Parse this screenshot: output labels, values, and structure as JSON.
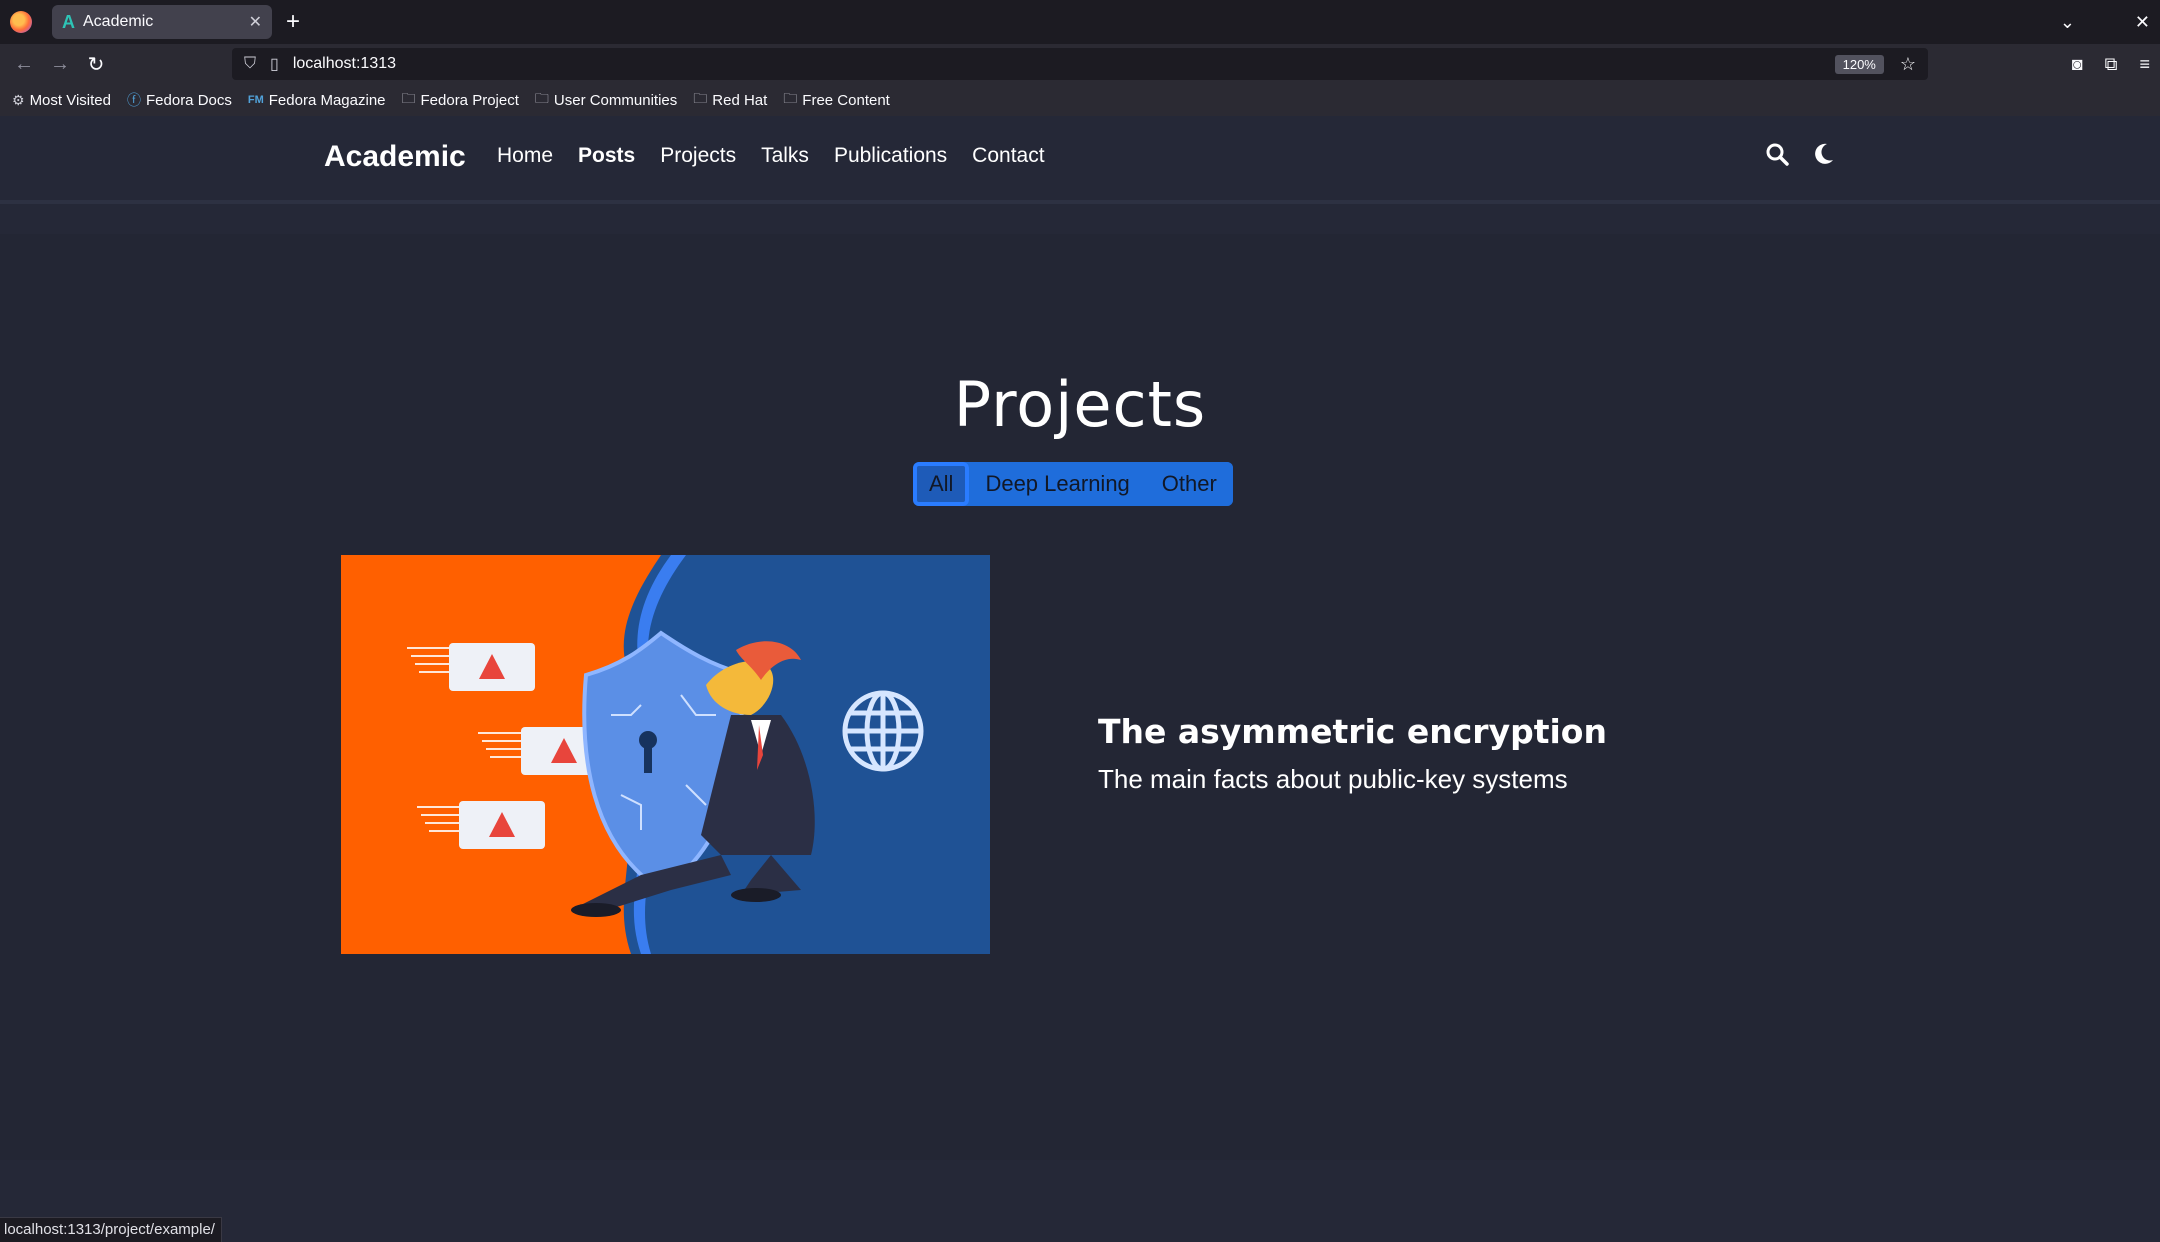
{
  "browser": {
    "tab_title": "Academic",
    "tab_favicon": "A",
    "url": "localhost:1313",
    "zoom": "120%",
    "bookmarks": [
      {
        "label": "Most Visited",
        "icon": "gear-icon"
      },
      {
        "label": "Fedora Docs",
        "icon": "fedora-icon"
      },
      {
        "label": "Fedora Magazine",
        "icon": "fm-icon"
      },
      {
        "label": "Fedora Project",
        "icon": "folder-icon"
      },
      {
        "label": "User Communities",
        "icon": "folder-icon"
      },
      {
        "label": "Red Hat",
        "icon": "folder-icon"
      },
      {
        "label": "Free Content",
        "icon": "folder-icon"
      }
    ],
    "status_url": "localhost:1313/project/example/"
  },
  "site": {
    "brand": "Academic",
    "menu": [
      {
        "label": "Home",
        "active": false
      },
      {
        "label": "Posts",
        "active": true
      },
      {
        "label": "Projects",
        "active": false
      },
      {
        "label": "Talks",
        "active": false
      },
      {
        "label": "Publications",
        "active": false
      },
      {
        "label": "Contact",
        "active": false
      }
    ]
  },
  "main": {
    "title": "Projects",
    "filters": [
      {
        "label": "All",
        "selected": true
      },
      {
        "label": "Deep Learning",
        "selected": false
      },
      {
        "label": "Other",
        "selected": false
      }
    ],
    "project": {
      "title": "The asymmetric encryption",
      "summary": "The main facts about public-key systems"
    }
  },
  "colors": {
    "background": "#232634",
    "accent": "#1f6ddb",
    "orange": "#ff6000",
    "blue_panel": "#1f5295"
  }
}
